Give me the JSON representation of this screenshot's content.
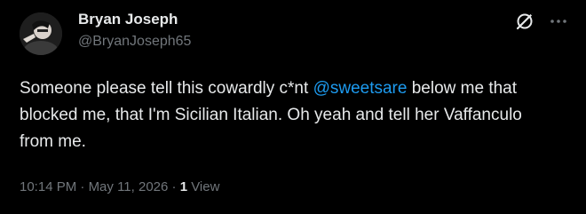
{
  "author": {
    "display_name": "Bryan Joseph",
    "handle": "@BryanJoseph65"
  },
  "tweet": {
    "text_before": "Someone please tell this cowardly c*nt ",
    "mention": "@sweetsare",
    "text_after": " below me that blocked me, that I'm Sicilian Italian. Oh yeah and tell her Vaffanculo from me."
  },
  "meta": {
    "time": "10:14 PM",
    "separator_1": " · ",
    "date": "May 11, 2026",
    "separator_2": " · ",
    "view_count": "1",
    "view_label": " View"
  },
  "icons": {
    "grok": "grok-icon",
    "more": "more-icon"
  },
  "colors": {
    "background": "#000000",
    "primary_text": "#e7e9ea",
    "secondary_text": "#71767b",
    "accent": "#1d9bf0"
  }
}
